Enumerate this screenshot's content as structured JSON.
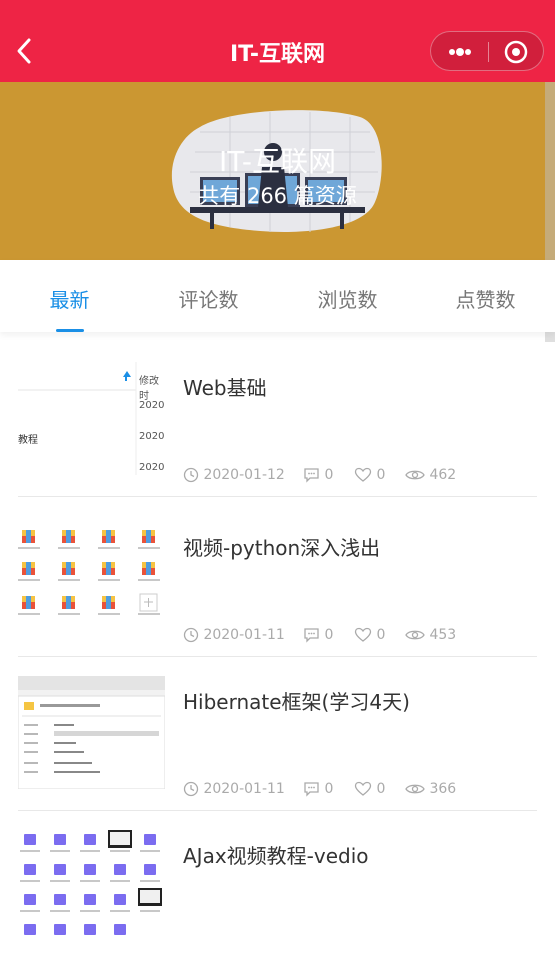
{
  "navbar": {
    "title": "IT-互联网",
    "accent": "#ee2445"
  },
  "banner": {
    "title": "IT-互联网",
    "count_text": "共有 266 篇资源",
    "bg": "#cb9732"
  },
  "tabs": [
    {
      "label": "最新",
      "active": true
    },
    {
      "label": "评论数"
    },
    {
      "label": "浏览数"
    },
    {
      "label": "点赞数"
    }
  ],
  "items": [
    {
      "title": "Web基础",
      "date": "2020-01-12",
      "comments": "0",
      "likes": "0",
      "views": "462",
      "thumb": {
        "header": "修改时",
        "label": "教程",
        "dates": [
          "2020-",
          "2020-",
          "2020-"
        ]
      }
    },
    {
      "title": "视频-python深入浅出",
      "date": "2020-01-11",
      "comments": "0",
      "likes": "0",
      "views": "453"
    },
    {
      "title": "Hibernate框架(学习4天)",
      "date": "2020-01-11",
      "comments": "0",
      "likes": "0",
      "views": "366"
    },
    {
      "title": "AJax视频教程-vedio",
      "date": "",
      "comments": "",
      "likes": "",
      "views": ""
    }
  ]
}
